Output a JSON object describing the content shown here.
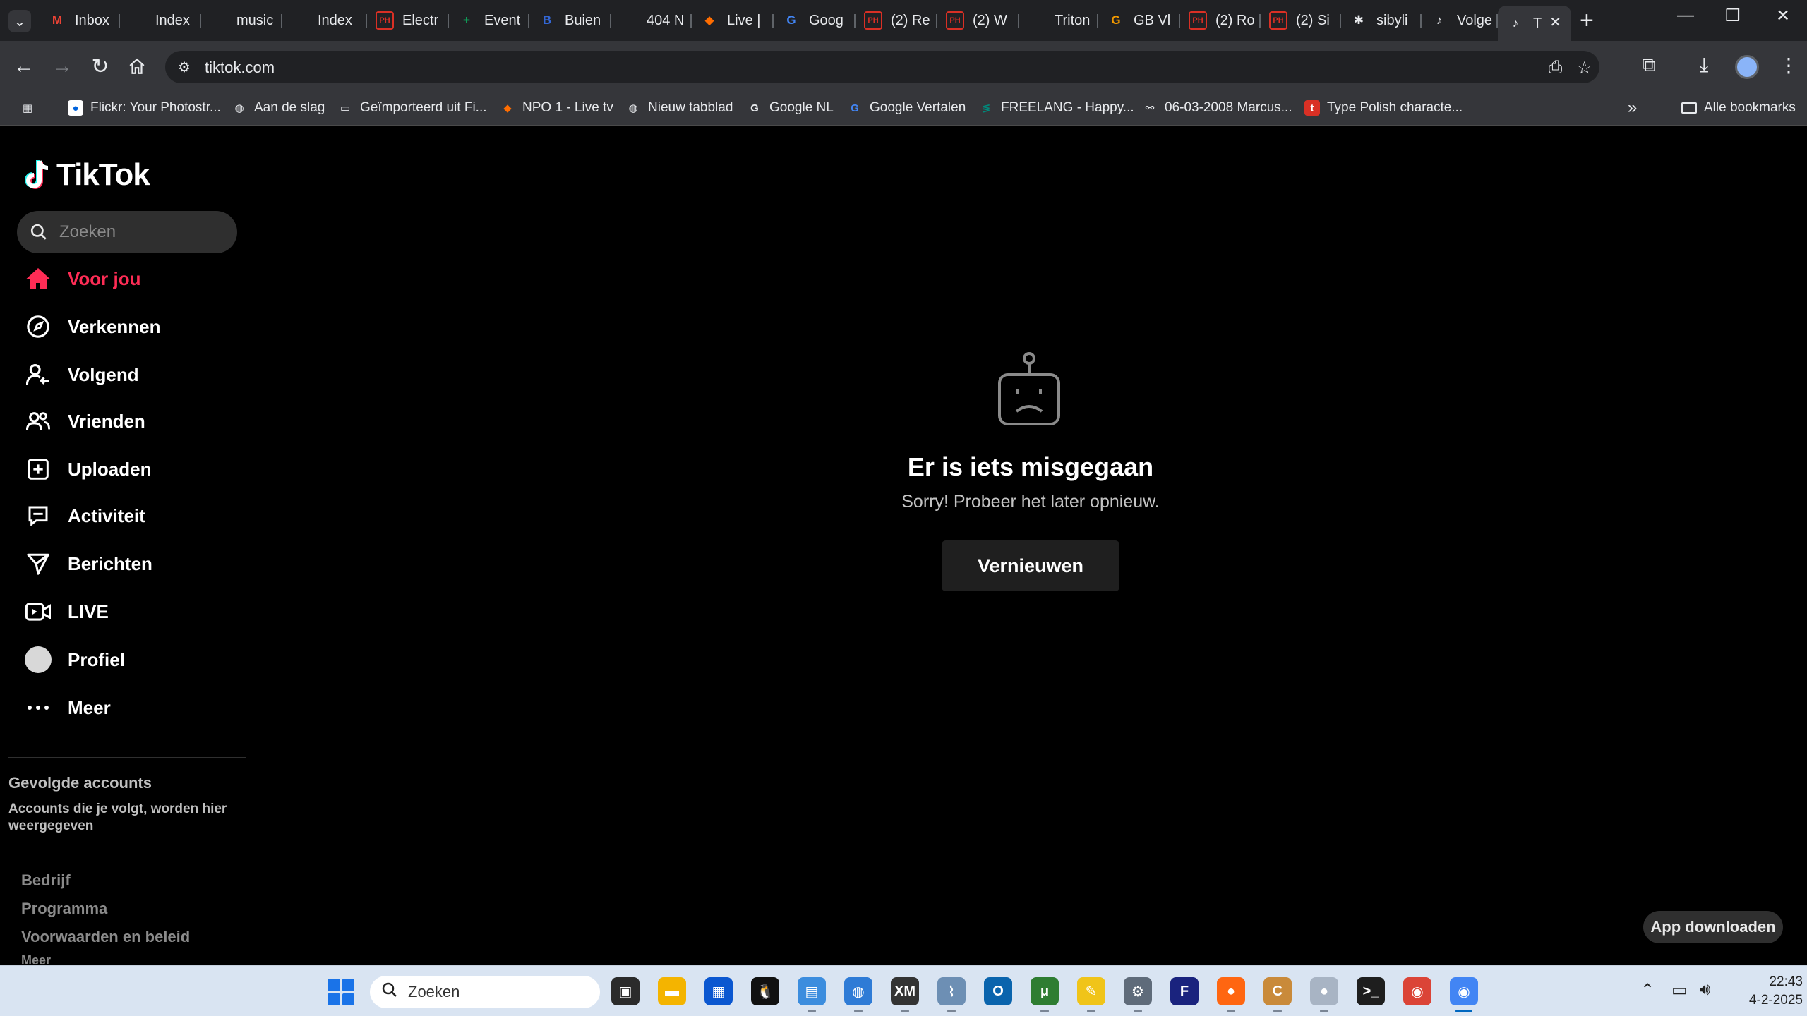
{
  "browser": {
    "tabs": [
      {
        "label": "Inbox",
        "icon": "gmail-icon",
        "color": "#ea4335",
        "glyph": "M"
      },
      {
        "label": "Index",
        "icon": "blank-page-icon",
        "color": "#202124",
        "glyph": ""
      },
      {
        "label": "music",
        "icon": "blank-page-icon",
        "color": "#202124",
        "glyph": ""
      },
      {
        "label": "Index",
        "icon": "blank-page-icon",
        "color": "#202124",
        "glyph": ""
      },
      {
        "label": "Electr",
        "icon": "reddit-ph-icon",
        "color": "#d93025",
        "glyph": "PH"
      },
      {
        "label": "Event",
        "icon": "sheets-icon",
        "color": "#0f9d58",
        "glyph": "+"
      },
      {
        "label": "Buien",
        "icon": "buienradar-icon",
        "color": "#3367d6",
        "glyph": "B"
      },
      {
        "label": "404 N",
        "icon": "blank-page-icon",
        "color": "#202124",
        "glyph": ""
      },
      {
        "label": "Live |",
        "icon": "npo-icon",
        "color": "#ff6d00",
        "glyph": "◆"
      },
      {
        "label": "Goog",
        "icon": "google-translate-icon",
        "color": "#4285f4",
        "glyph": "G"
      },
      {
        "label": "(2) Re",
        "icon": "reddit-ph-icon",
        "color": "#d93025",
        "glyph": "PH"
      },
      {
        "label": "(2) W",
        "icon": "reddit-ph-icon",
        "color": "#d93025",
        "glyph": "PH"
      },
      {
        "label": "Triton",
        "icon": "blank-page-icon",
        "color": "#202124",
        "glyph": ""
      },
      {
        "label": "GB Vl",
        "icon": "gb-icon",
        "color": "#f29900",
        "glyph": "G"
      },
      {
        "label": "(2) Ro",
        "icon": "reddit-ph-icon",
        "color": "#d93025",
        "glyph": "PH"
      },
      {
        "label": "(2) Si",
        "icon": "reddit-ph-icon",
        "color": "#d93025",
        "glyph": "PH"
      },
      {
        "label": "sibyli",
        "icon": "asterisk-icon",
        "color": "#202124",
        "glyph": "✱"
      },
      {
        "label": "Volge",
        "icon": "tiktok-icon",
        "color": "#202124",
        "glyph": "♪"
      },
      {
        "label": "T",
        "icon": "tiktok-icon",
        "color": "#202124",
        "glyph": "♪"
      }
    ],
    "url": "tiktok.com",
    "bookmarks": [
      {
        "label": "",
        "icon": "apps-grid-icon"
      },
      {
        "label": "Flickr: Your Photostr...",
        "icon": "flickr-icon"
      },
      {
        "label": "Aan de slag",
        "icon": "globe-icon"
      },
      {
        "label": "Geïmporteerd uit Fi...",
        "icon": "folder-icon"
      },
      {
        "label": "NPO 1 - Live tv",
        "icon": "npo-icon"
      },
      {
        "label": "Nieuw tabblad",
        "icon": "globe-icon"
      },
      {
        "label": "Google NL",
        "icon": "google-icon"
      },
      {
        "label": "Google Vertalen",
        "icon": "google-translate-icon"
      },
      {
        "label": "FREELANG - Happy...",
        "icon": "freelang-icon"
      },
      {
        "label": "06-03-2008 Marcus...",
        "icon": "link-icon"
      },
      {
        "label": "Type Polish characte...",
        "icon": "type-polish-icon"
      }
    ],
    "all_bookmarks": "Alle bookmarks"
  },
  "tiktok": {
    "logo": "TikTok",
    "search_placeholder": "Zoeken",
    "nav": [
      {
        "label": "Voor jou",
        "icon": "home-icon",
        "active": true
      },
      {
        "label": "Verkennen",
        "icon": "compass-icon",
        "active": false
      },
      {
        "label": "Volgend",
        "icon": "following-icon",
        "active": false
      },
      {
        "label": "Vrienden",
        "icon": "friends-icon",
        "active": false
      },
      {
        "label": "Uploaden",
        "icon": "upload-icon",
        "active": false
      },
      {
        "label": "Activiteit",
        "icon": "activity-icon",
        "active": false
      },
      {
        "label": "Berichten",
        "icon": "messages-icon",
        "active": false
      },
      {
        "label": "LIVE",
        "icon": "live-icon",
        "active": false
      },
      {
        "label": "Profiel",
        "icon": "profile-avatar-icon",
        "active": false
      },
      {
        "label": "Meer",
        "icon": "more-dots-icon",
        "active": false
      }
    ],
    "following_title": "Gevolgde accounts",
    "following_subtitle": "Accounts die je volgt, worden hier weergegeven",
    "footer_links": [
      "Bedrijf",
      "Programma",
      "Voorwaarden en beleid",
      "Meer"
    ],
    "error_title": "Er is iets misgegaan",
    "error_subtitle": "Sorry! Probeer het later opnieuw.",
    "refresh_button": "Vernieuwen",
    "app_download": "App downloaden",
    "accent_color": "#fe2c55"
  },
  "taskbar": {
    "search_placeholder": "Zoeken",
    "time": "22:43",
    "date": "4-2-2025",
    "apps": [
      {
        "name": "task-view-icon",
        "color": "#2b2b2b",
        "glyph": "▣",
        "running": false
      },
      {
        "name": "file-explorer-icon",
        "color": "#f4b400",
        "glyph": "▬",
        "running": false
      },
      {
        "name": "store-icon",
        "color": "#0b57d0",
        "glyph": "▦",
        "running": false
      },
      {
        "name": "linux-penguin-icon",
        "color": "#111111",
        "glyph": "🐧",
        "running": false
      },
      {
        "name": "remote-desktop-icon",
        "color": "#3c8dde",
        "glyph": "▤",
        "running": true
      },
      {
        "name": "network-globe-icon",
        "color": "#2e7bd6",
        "glyph": "◍",
        "running": true
      },
      {
        "name": "xm-play-icon",
        "color": "#333333",
        "glyph": "XM",
        "running": true
      },
      {
        "name": "monitor-graph-icon",
        "color": "#6d8fb4",
        "glyph": "⌇",
        "running": true
      },
      {
        "name": "outlook-icon",
        "color": "#0a64ad",
        "glyph": "O",
        "running": false
      },
      {
        "name": "torrent-icon",
        "color": "#2e7d32",
        "glyph": "μ",
        "running": true
      },
      {
        "name": "pencil-tool-icon",
        "color": "#f0c419",
        "glyph": "✎",
        "running": true
      },
      {
        "name": "settings-gear-icon",
        "color": "#5f6b7a",
        "glyph": "⚙",
        "running": true
      },
      {
        "name": "f-app-icon",
        "color": "#1a237e",
        "glyph": "F",
        "running": false
      },
      {
        "name": "firefox-icon",
        "color": "#ff6611",
        "glyph": "●",
        "running": true
      },
      {
        "name": "c-app-icon",
        "color": "#c98a3a",
        "glyph": "C",
        "running": true
      },
      {
        "name": "sphere-icon",
        "color": "#a8b4c4",
        "glyph": "●",
        "running": true
      },
      {
        "name": "terminal-icon",
        "color": "#1e1e1e",
        "glyph": ">_",
        "running": false
      },
      {
        "name": "chrome-profile-icon",
        "color": "#db4437",
        "glyph": "◉",
        "running": false
      },
      {
        "name": "chrome-icon",
        "color": "#4285f4",
        "glyph": "◉",
        "running": true,
        "active": true
      }
    ]
  }
}
